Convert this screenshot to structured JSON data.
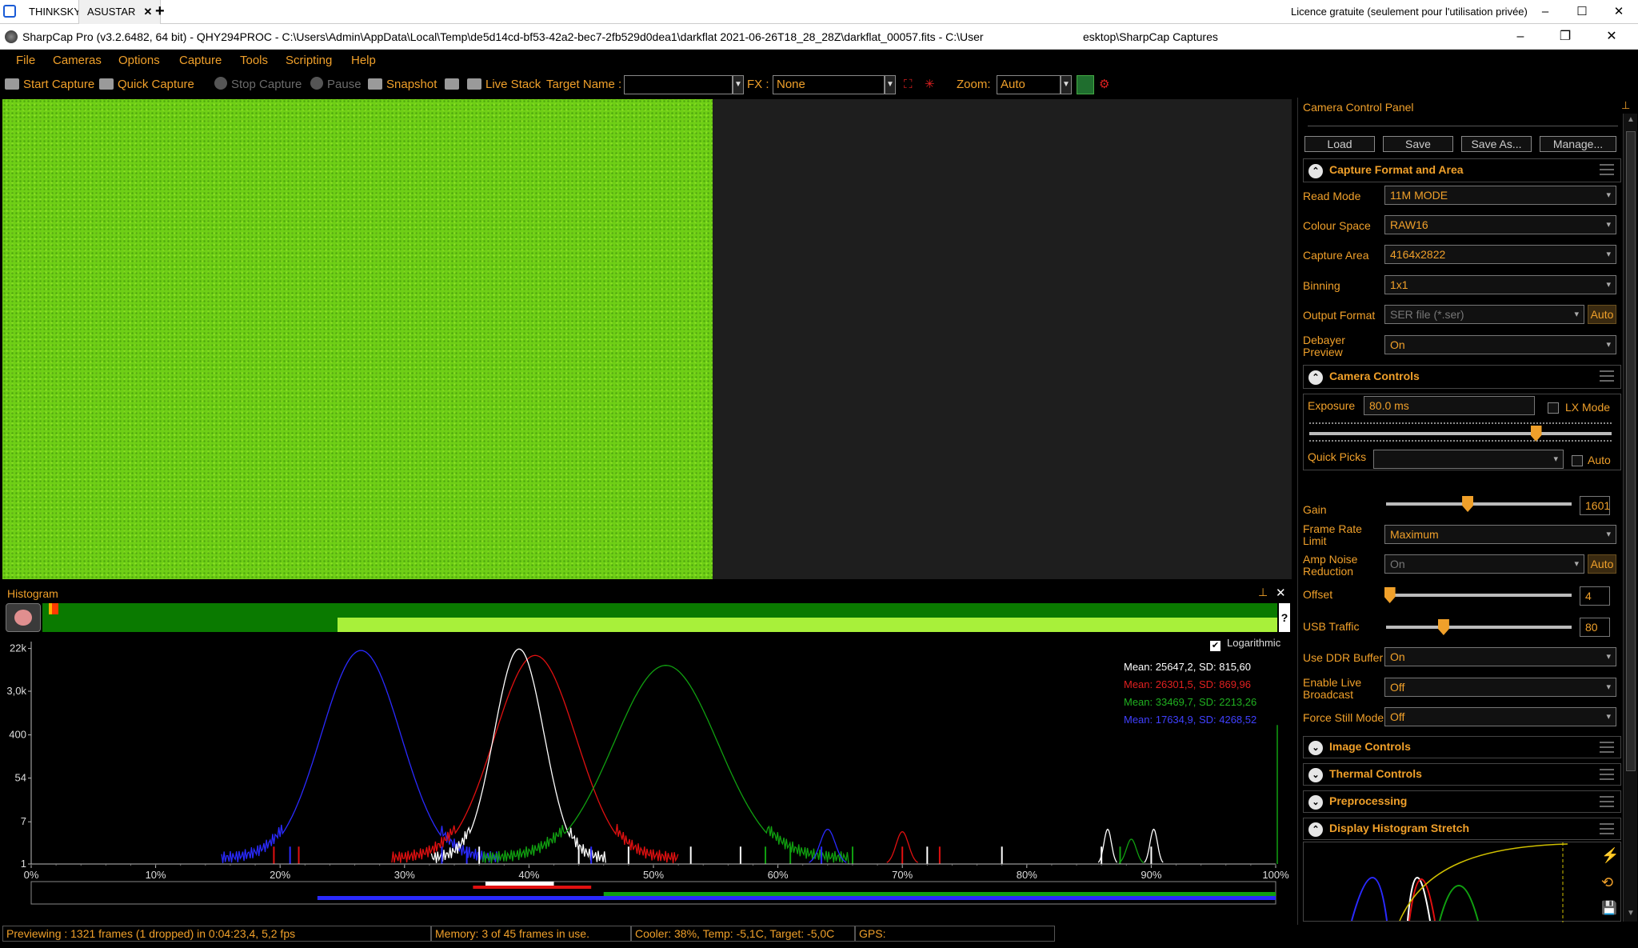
{
  "remote": {
    "tabs": [
      {
        "label": "THINKSKY"
      },
      {
        "label": "ASUSTAR",
        "close": "✕"
      }
    ],
    "add_tab": "+",
    "license": "Licence gratuite (seulement pour l'utilisation privée)",
    "win": {
      "min": "–",
      "max": "☐",
      "close": "✕"
    }
  },
  "titlebar": {
    "title": "SharpCap Pro (v3.2.6482, 64 bit) - QHY294PROC - C:\\Users\\Admin\\AppData\\Local\\Temp\\de5d14cd-bf53-42a2-bec7-2fb529d0dea1\\darkflat 2021-06-26T18_28_28Z\\darkflat_00057.fits - C:\\User",
    "title_tail": "esktop\\SharpCap Captures",
    "min": "–",
    "max": "❐",
    "close": "✕"
  },
  "menu": [
    "File",
    "Cameras",
    "Options",
    "Capture",
    "Tools",
    "Scripting",
    "Help"
  ],
  "toolbar": {
    "start_capture": "Start Capture",
    "quick_capture": "Quick Capture",
    "stop_capture": "Stop Capture",
    "pause": "Pause",
    "snapshot": "Snapshot",
    "live_stack": "Live Stack",
    "target_name_label": "Target Name :",
    "target_name_value": "",
    "fx_label": "FX :",
    "fx_value": "None",
    "zoom_label": "Zoom:",
    "zoom_value": "Auto"
  },
  "histogram": {
    "title": "Histogram",
    "pin": "📌",
    "close": "✕",
    "help": "?",
    "logarithmic_label": "Logarithmic",
    "logarithmic_checked": true,
    "y_ticks": [
      "22k",
      "3,0k",
      "400",
      "54",
      "7",
      "1"
    ],
    "x_ticks": [
      "0%",
      "10%",
      "20%",
      "30%",
      "40%",
      "50%",
      "60%",
      "70%",
      "80%",
      "90%",
      "100%"
    ],
    "stats": [
      {
        "text": "Mean: 25647,2, SD: 815,60",
        "color": "#ffffff"
      },
      {
        "text": "Mean: 26301,5, SD: 869,96",
        "color": "#e02020"
      },
      {
        "text": "Mean: 33469,7, SD: 2213,26",
        "color": "#20b020"
      },
      {
        "text": "Mean: 17634,9, SD: 4268,52",
        "color": "#4040ff"
      }
    ],
    "series": [
      {
        "name": "blue",
        "color": "#2a2aff",
        "peak_pct": 26.5,
        "width_pct": 3.5,
        "peak_log": 4.3
      },
      {
        "name": "red",
        "color": "#e01010",
        "peak_pct": 40.5,
        "width_pct": 3.6,
        "peak_log": 4.2
      },
      {
        "name": "white",
        "color": "#ffffff",
        "peak_pct": 39.2,
        "width_pct": 2.2,
        "peak_log": 4.33
      },
      {
        "name": "green",
        "color": "#10a010",
        "peak_pct": 51,
        "width_pct": 4.6,
        "peak_log": 4.0
      }
    ]
  },
  "status": {
    "preview": "Previewing : 1321 frames (1 dropped) in 0:04:23,4, 5,2 fps",
    "memory": "Memory: 3 of 45 frames in use.",
    "cooler": "Cooler: 38%, Temp: -5,1C, Target: -5,0C",
    "gps": "GPS:"
  },
  "panel": {
    "title": "Camera Control Panel",
    "pin": "📌",
    "buttons": [
      "Load",
      "Save",
      "Save As...",
      "Manage..."
    ],
    "capture_format": {
      "title": "Capture Format and Area",
      "read_mode": {
        "label": "Read Mode",
        "value": "11M MODE"
      },
      "colour_space": {
        "label": "Colour Space",
        "value": "RAW16"
      },
      "capture_area": {
        "label": "Capture Area",
        "value": "4164x2822"
      },
      "binning": {
        "label": "Binning",
        "value": "1x1"
      },
      "output_format": {
        "label": "Output Format",
        "value": "SER file (*.ser)",
        "auto": "Auto"
      },
      "debayer_preview": {
        "label": "Debayer Preview",
        "value": "On"
      }
    },
    "camera_controls": {
      "title": "Camera Controls",
      "exposure": {
        "label": "Exposure",
        "value": "80.0 ms",
        "lx_mode": "LX Mode",
        "slider_fraction": 0.75
      },
      "quick_picks": {
        "label": "Quick Picks",
        "value": "",
        "auto": "Auto"
      },
      "gain": {
        "label": "Gain",
        "value": "1601",
        "slider_fraction": 0.44
      },
      "frame_rate_limit": {
        "label": "Frame Rate Limit",
        "value": "Maximum"
      },
      "amp_noise_reduction": {
        "label": "Amp Noise Reduction",
        "value": "On",
        "auto": "Auto"
      },
      "offset": {
        "label": "Offset",
        "value": "4",
        "slider_fraction": 0.02
      },
      "usb_traffic": {
        "label": "USB Traffic",
        "value": "80",
        "slider_fraction": 0.31
      },
      "use_ddr_buffer": {
        "label": "Use DDR Buffer",
        "value": "On"
      },
      "enable_live_broadcast": {
        "label": "Enable Live Broadcast",
        "value": "Off"
      },
      "force_still_mode": {
        "label": "Force Still Mode",
        "value": "Off"
      }
    },
    "sections": [
      "Image Controls",
      "Thermal Controls",
      "Preprocessing",
      "Display Histogram Stretch"
    ]
  }
}
